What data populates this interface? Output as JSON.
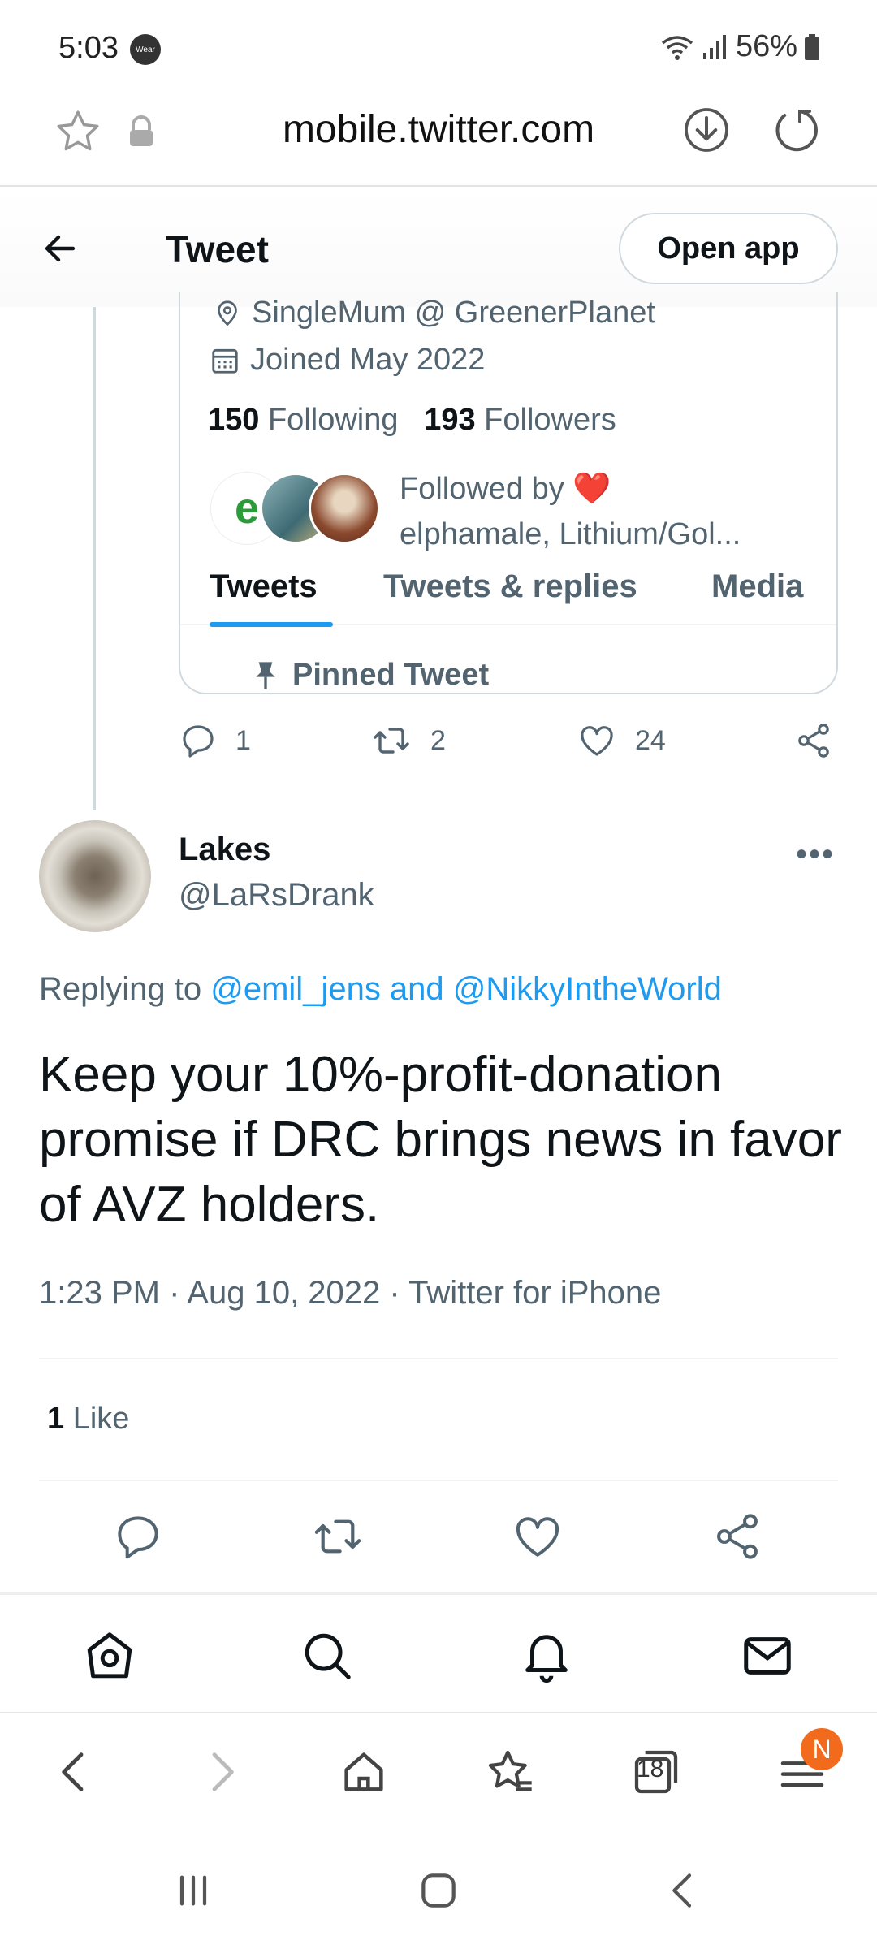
{
  "status_bar": {
    "time": "5:03",
    "wear_badge": "Wear",
    "battery": "56%"
  },
  "browser": {
    "url": "mobile.twitter.com"
  },
  "header": {
    "title": "Tweet",
    "open_app": "Open app"
  },
  "profile_card": {
    "location": "SingleMum @ GreenerPlanet",
    "joined": "Joined May 2022",
    "following_count": "150",
    "following_label": "Following",
    "followers_count": "193",
    "followers_label": "Followers",
    "followed_by_label": "Followed by",
    "followed_by_names": "elphamale, Lithium/Gol...",
    "avatar1_letter": "e",
    "tabs": [
      "Tweets",
      "Tweets & replies",
      "Media"
    ],
    "pinned": "Pinned Tweet"
  },
  "quoted_actions": {
    "replies": "1",
    "retweets": "2",
    "likes": "24"
  },
  "tweet": {
    "author_name": "Lakes",
    "author_handle": "@LaRsDrank",
    "more": "•••",
    "replying_prefix": "Replying to",
    "replying_mentions": "@emil_jens and @NikkyIntheWorld",
    "text": "Keep your 10%-profit-donation promise if DRC brings news in favor of AVZ holders.",
    "meta": "1:23 PM · Aug 10, 2022 · Twitter for iPhone",
    "likes_count": "1",
    "likes_label": "Like"
  },
  "browser_toolbar": {
    "tab_count": "18",
    "notification_badge": "N"
  },
  "icons": {
    "twitter_nav": [
      "home-icon",
      "search-icon",
      "bell-icon",
      "mail-icon"
    ],
    "browser_toolbar": [
      "back-icon",
      "forward-icon",
      "home-icon",
      "bookmarks-icon",
      "tabs-icon",
      "menu-icon"
    ],
    "system_nav": [
      "recents-icon",
      "home-icon",
      "back-icon"
    ]
  },
  "colors": {
    "accent": "#1d9bf0",
    "text": "#0f1419",
    "secondary": "#536471",
    "badge": "#f26a1b"
  }
}
